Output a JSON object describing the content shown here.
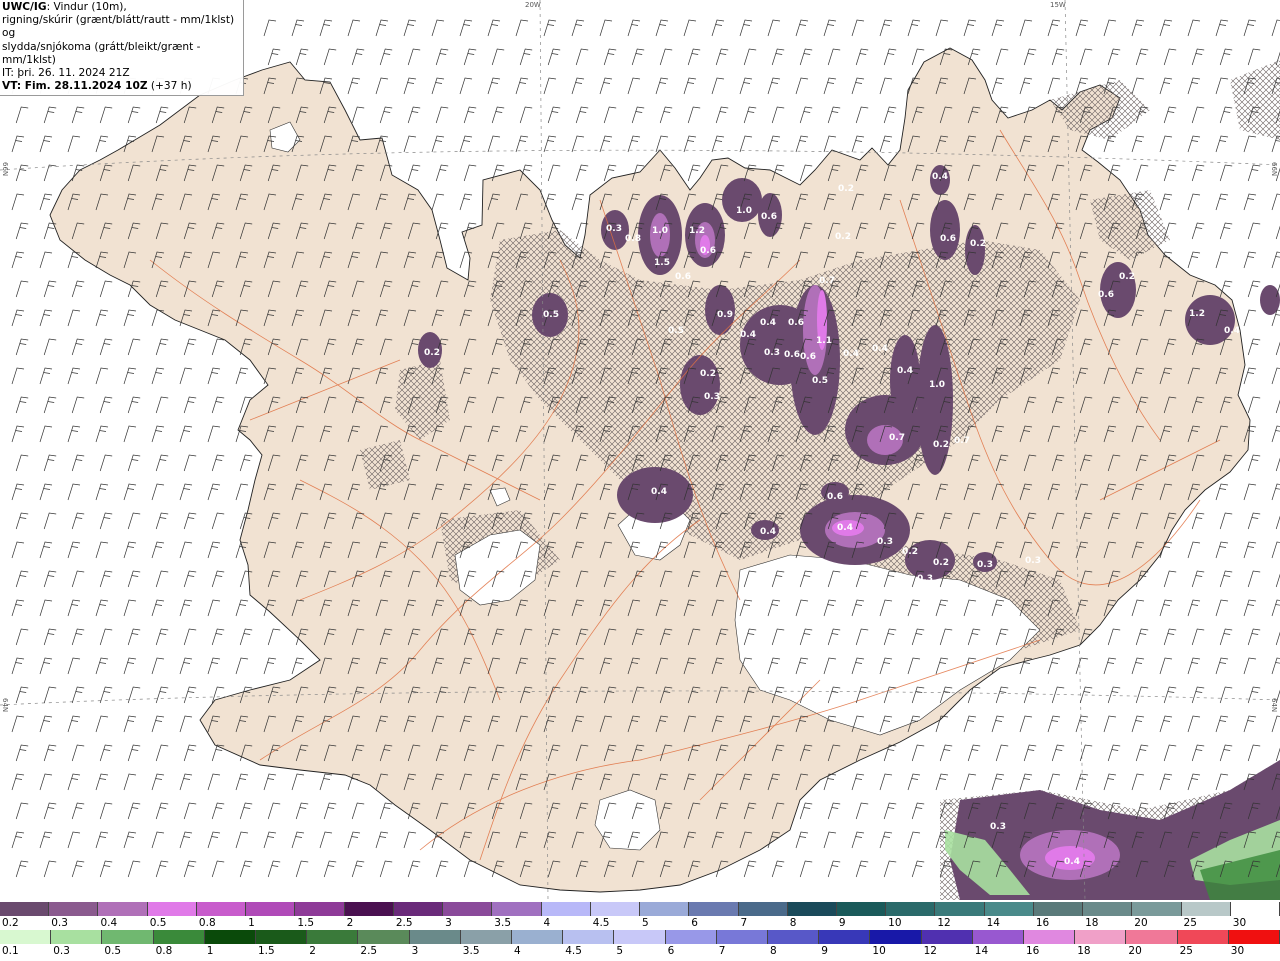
{
  "info": {
    "model": "UWC/IG",
    "line1_rest": ": Vindur (10m),",
    "line2": "rigning/skúrir (grænt/blátt/rautt - mm/1klst) og",
    "line3": "slydda/snjókoma (grátt/bleikt/grænt - mm/1klst)",
    "line4": "IT: þri. 26. 11. 2024 21Z",
    "line5_bold": "VT: Fim. 28.11.2024 10Z",
    "line5_rest": " (+37 h)"
  },
  "grid_labels": {
    "lon_20w": "20W",
    "lon_15w": "15W",
    "lat_66n": "66N",
    "lat_64n": "64N"
  },
  "precip_labels": [
    "0.5",
    "0.2",
    "0.3",
    "0.8",
    "1.0",
    "1.2",
    "0.6",
    "1.5",
    "0.6",
    "1.0",
    "0.6",
    "0.9",
    "0.5",
    "0.2",
    "0.3",
    "0.4",
    "0.4",
    "0.3",
    "0.6",
    "0.6",
    "1.1",
    "0.5",
    "0.7",
    "0.6",
    "0.4",
    "0.4",
    "0.4",
    "1.0",
    "0.7",
    "0.2",
    "0.7",
    "0.4",
    "0.6",
    "0.4",
    "0.4",
    "0.3",
    "0.2",
    "0.2",
    "0.3",
    "0.3",
    "0.3",
    "0.6",
    "1.2",
    "0.2",
    "0.4",
    "0.6",
    "0.2",
    "0.4",
    "0.2",
    "0.2",
    "0.3",
    "0.4"
  ],
  "snow_scale": {
    "labels": [
      "0.2",
      "0.3",
      "0.4",
      "0.5",
      "0.8",
      "1",
      "1.5",
      "2",
      "2.5",
      "3",
      "3.5",
      "4",
      "4.5",
      "5",
      "6",
      "7",
      "8",
      "9",
      "10",
      "12",
      "14",
      "16",
      "18",
      "20",
      "25",
      "30"
    ],
    "colors": [
      "#6a4a6e",
      "#8a5a8e",
      "#b070b8",
      "#e07ae8",
      "#c85ccc",
      "#b04ab8",
      "#8e3a98",
      "#4a1050",
      "#6a2a7a",
      "#8a4a9a",
      "#a070c0",
      "#b8b8f8",
      "#c8c8f8",
      "#9aaad8",
      "#6a7ab0",
      "#4a6a8a",
      "#1a4a5a",
      "#1a5a5a",
      "#2a6a6a",
      "#3a7a7a",
      "#4a8a8a",
      "#5a7a7a",
      "#6a8a8a",
      "#7a9a9a",
      "#b8c8c8",
      "#ffffff"
    ]
  },
  "rain_scale": {
    "labels": [
      "0.1",
      "0.3",
      "0.5",
      "0.8",
      "1",
      "1.5",
      "2",
      "2.5",
      "3",
      "3.5",
      "4",
      "4.5",
      "5",
      "6",
      "7",
      "8",
      "9",
      "10",
      "12",
      "14",
      "16",
      "18",
      "20",
      "25",
      "30"
    ],
    "colors": [
      "#d8f8d0",
      "#a8e0a0",
      "#70b870",
      "#3a8a3a",
      "#0a4a0a",
      "#1a5a1a",
      "#3a7a3a",
      "#5a8a5a",
      "#6a8a8a",
      "#8aa0a8",
      "#9ab0d0",
      "#b8c0f0",
      "#c8c8f8",
      "#9898e8",
      "#7878d8",
      "#5858c8",
      "#3838b8",
      "#1818a8",
      "#5030b0",
      "#9858d0",
      "#e088e0",
      "#f0a0c8",
      "#f07898",
      "#f04858",
      "#f01010"
    ]
  }
}
